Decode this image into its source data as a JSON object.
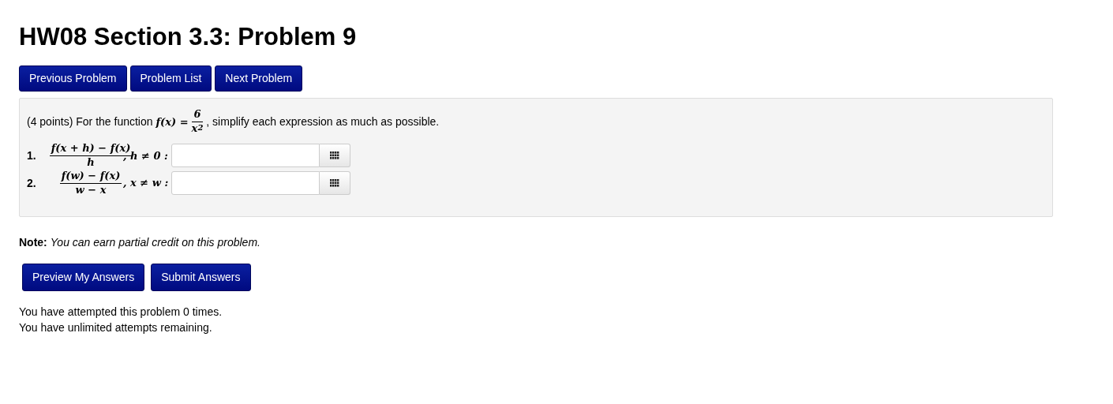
{
  "title": "HW08 Section 3.3: Problem 9",
  "nav_buttons": [
    "Previous Problem",
    "Problem List",
    "Next Problem"
  ],
  "problem": {
    "intro": "(4 points) For the function",
    "function_lhs": "f(x) =",
    "function_num": "6",
    "function_den": "x$^{2}$",
    "intro_end": ", simplify each expression as much as possible.",
    "parts": [
      {
        "number": "1.",
        "numerator": "f(x + h) − f(x)",
        "denominator": "h",
        "condition": ", h ≠ 0 :"
      },
      {
        "number": "2.",
        "numerator": "f(w) − f(x)",
        "denominator": "w − x",
        "condition": ", x ≠ w :"
      }
    ]
  },
  "note": {
    "label": "Note:",
    "text": "You can earn partial credit on this problem."
  },
  "action_buttons": [
    "Preview My Answers",
    "Submit Answers"
  ],
  "attempts": [
    "You have attempted this problem 0 times.",
    "You have unlimited attempts remaining."
  ]
}
